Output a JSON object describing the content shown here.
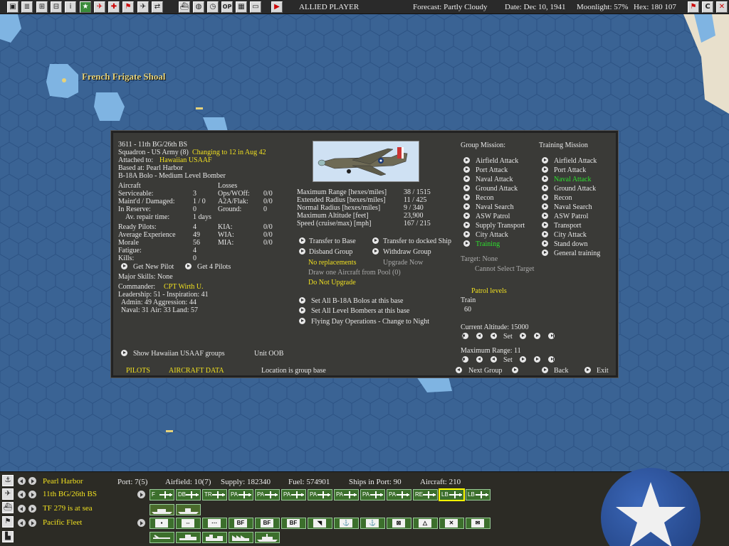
{
  "topbar": {
    "player": "ALLIED PLAYER",
    "forecast": "Forecast: Partly Cloudy",
    "date": "Date: Dec 10, 1941",
    "moonlight": "Moonlight: 57%",
    "hex": "Hex: 180 107",
    "op_label": "OP"
  },
  "map": {
    "label": "French Frigate Shoal"
  },
  "dialog": {
    "unit_line": "3611 - 11th BG/26th BS",
    "squadron": "Squadron - US Army (8)",
    "changing": "Changing to 12 in Aug 42",
    "attached_label": "Attached to:",
    "attached_value": "Hawaiian USAAF",
    "based": "Based at: Pearl Harbor",
    "aircraft_type": "B-18A Bolo - Medium Level Bomber",
    "aircraft_header": "Aircraft",
    "losses_header": "Losses",
    "left_stats": [
      {
        "label": "Serviceable:",
        "value": "3"
      },
      {
        "label": "Maint'd / Damaged:",
        "value": "1 / 0"
      },
      {
        "label": "In Reserve:",
        "value": "0"
      },
      {
        "label": "Av. repair time:",
        "value": "1 days"
      },
      {
        "label": "Ready Pilots:",
        "value": "4"
      },
      {
        "label": "Average Experience",
        "value": "49"
      },
      {
        "label": "Morale",
        "value": "56"
      },
      {
        "label": "Fatigue:",
        "value": "4"
      },
      {
        "label": "Kills:",
        "value": "0"
      }
    ],
    "loss_stats": [
      {
        "label": "Ops/WOff:",
        "value": "0/0"
      },
      {
        "label": "A2A/Flak:",
        "value": "0/0"
      },
      {
        "label": "Ground:",
        "value": "0"
      },
      {
        "label": "KIA:",
        "value": "0/0"
      },
      {
        "label": "WIA:",
        "value": "0/0"
      },
      {
        "label": "MIA:",
        "value": "0/0"
      }
    ],
    "get_new_pilot": "Get New Pilot",
    "get_4_pilots": "Get 4 Pilots",
    "major_skills": "Major Skills: None",
    "commander_label": "Commander:",
    "commander_value": "CPT Wirth U.",
    "leadership": "Leadership: 51 - Inspiration: 41",
    "admin": "Admin: 49  Aggression: 44",
    "naval": "Naval: 31  Air: 33  Land: 57",
    "show_groups": "Show Hawaiian USAAF groups",
    "unit_oob": "Unit OOB",
    "pilots_tab": "PILOTS",
    "aircraft_data_tab": "AIRCRAFT DATA",
    "location_note": "Location is group base",
    "perf": [
      {
        "label": "Maximum Range [hexes/miles]",
        "value": "38 / 1515"
      },
      {
        "label": "Extended Radius [hexes/miles]",
        "value": "11 / 425"
      },
      {
        "label": "Normal Radius [hexes/miles]",
        "value": "9 / 340"
      },
      {
        "label": "Maximum Altitude [feet]",
        "value": "23,900"
      },
      {
        "label": "Speed (cruise/max) [mph]",
        "value": "167 / 215"
      }
    ],
    "transfer_base": "Transfer to Base",
    "transfer_ship": "Transfer to docked Ship",
    "disband": "Disband Group",
    "withdraw": "Withdraw Group",
    "no_replacements": "No replacements",
    "upgrade_now": "Upgrade Now",
    "draw_one": "Draw one Aircraft from Pool (0)",
    "do_not_upgrade": "Do Not Upgrade",
    "set_all_bolos": "Set All B-18A Bolos at this base",
    "set_all_bombers": "Set All Level Bombers at this base",
    "flying_ops": "Flying Day Operations - Change to Night",
    "group_mission_header": "Group Mission:",
    "group_missions": [
      "Airfield Attack",
      "Port Attack",
      "Naval Attack",
      "Ground Attack",
      "Recon",
      "Naval Search",
      "ASW Patrol",
      "Supply Transport",
      "City Attack",
      "Training"
    ],
    "training_mission_header": "Training Mission",
    "training_missions": [
      "Airfield Attack",
      "Port Attack",
      "Naval Attack",
      "Ground Attack",
      "Recon",
      "Naval Search",
      "ASW Patrol",
      "Transport",
      "City Attack",
      "Stand down",
      "General training"
    ],
    "target": "Target: None",
    "cannot_select": "Cannot Select Target",
    "patrol_levels": "Patrol levels",
    "train_label": "Train",
    "train_value": "60",
    "current_altitude": "Current Altitude: 15000",
    "set_label": "Set",
    "maximum_range": "Maximum Range: 11",
    "next_group": "Next Group",
    "back": "Back",
    "exit": "Exit"
  },
  "bottombar": {
    "base": "Pearl Harbor",
    "group": "11th BG/26th BS",
    "tf": "TF 279 is at sea",
    "fleet": "Pacific Fleet",
    "port": "Port: 7(5)",
    "airfield": "Airfield: 10(7)",
    "supply": "Supply: 182340",
    "fuel": "Fuel: 574901",
    "ships": "Ships in Port: 90",
    "aircraft": "Aircraft: 210",
    "ac_buttons": [
      "F",
      "DB",
      "TR",
      "PA",
      "PA",
      "PA",
      "PA",
      "PA",
      "PA",
      "PA",
      "RE",
      "LB",
      "LB",
      "LB"
    ],
    "ship_buttons": [
      "",
      "",
      "",
      "BF",
      "BF",
      "BF",
      "",
      "",
      "",
      "",
      "",
      "",
      ""
    ]
  },
  "colors": {
    "dialog_bg": "#3a3a37",
    "highlight_yellow": "#f0e020",
    "highlight_green": "#2ee02e",
    "map_sea": "#3a6394"
  }
}
